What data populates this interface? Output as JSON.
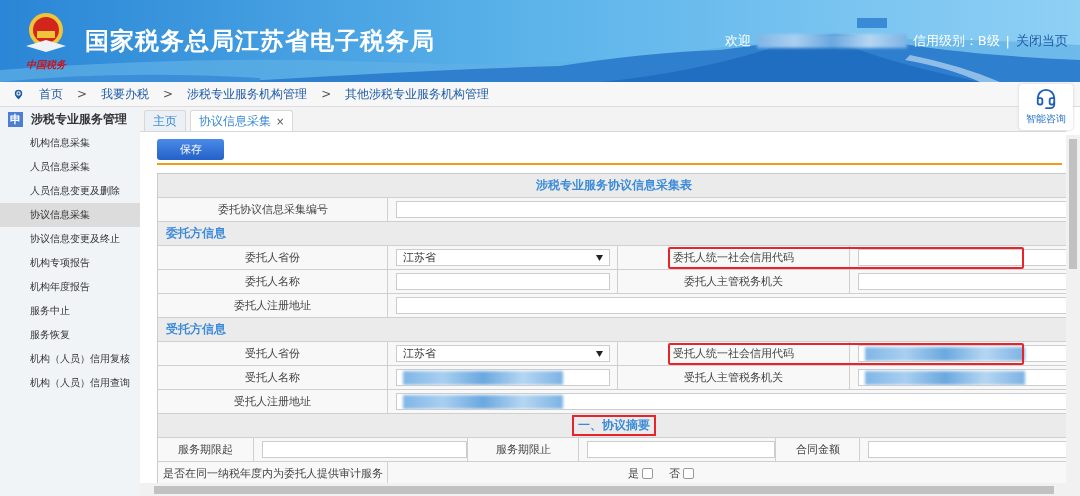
{
  "header": {
    "logo_caption": "中国税务",
    "title": "国家税务总局江苏省电子税务局",
    "welcome": "欢迎",
    "name_redacted": true,
    "credit": "信用级别：B级",
    "separator": "|",
    "close": "关闭当页"
  },
  "breadcrumb": {
    "separator": ">",
    "items": [
      "首页",
      "我要办税",
      "涉税专业服务机构管理",
      "其他涉税专业服务机构管理"
    ]
  },
  "assistant": {
    "label": "智能咨询"
  },
  "sidebar": {
    "badge": "申",
    "heading": "涉税专业服务管理",
    "items": [
      {
        "label": "机构信息采集",
        "selected": false
      },
      {
        "label": "人员信息采集",
        "selected": false
      },
      {
        "label": "人员信息变更及删除",
        "selected": false
      },
      {
        "label": "协议信息采集",
        "selected": true
      },
      {
        "label": "协议信息变更及终止",
        "selected": false
      },
      {
        "label": "机构专项报告",
        "selected": false
      },
      {
        "label": "机构年度报告",
        "selected": false
      },
      {
        "label": "服务中止",
        "selected": false
      },
      {
        "label": "服务恢复",
        "selected": false
      },
      {
        "label": "机构（人员）信用复核",
        "selected": false
      },
      {
        "label": "机构（人员）信用查询",
        "selected": false
      }
    ]
  },
  "tabs": [
    {
      "label": "主页",
      "selected": false
    },
    {
      "label": "协议信息采集",
      "selected": true,
      "close": "×"
    }
  ],
  "save_button": "保存",
  "form": {
    "title": "涉税专业服务协议信息采集表",
    "number_label": "委托协议信息采集编号",
    "sections": [
      {
        "heading": "委托方信息",
        "rows": [
          {
            "kind": "pair",
            "left": {
              "label": "委托人省份",
              "kind": "select",
              "value": "江苏省",
              "redacted": false
            },
            "right": {
              "label": "委托人统一社会信用代码",
              "highlighted": true,
              "redacted": false
            }
          },
          {
            "kind": "pair",
            "left": {
              "label": "委托人名称",
              "kind": "input",
              "redacted": false
            },
            "right": {
              "label": "委托人主管税务机关",
              "highlighted": false,
              "redacted": false
            }
          },
          {
            "kind": "wide",
            "label": "委托人注册地址",
            "redacted": false
          }
        ]
      },
      {
        "heading": "受托方信息",
        "rows": [
          {
            "kind": "pair",
            "left": {
              "label": "受托人省份",
              "kind": "select",
              "value": "江苏省",
              "redacted": false
            },
            "right": {
              "label": "受托人统一社会信用代码",
              "highlighted": true,
              "redacted": true
            }
          },
          {
            "kind": "pair",
            "left": {
              "label": "受托人名称",
              "kind": "input",
              "redacted": true
            },
            "right": {
              "label": "受托人主管税务机关",
              "highlighted": false,
              "redacted": true
            }
          },
          {
            "kind": "wide",
            "label": "受托人注册地址",
            "redacted": true
          }
        ]
      }
    ],
    "summary": {
      "heading": "一、协议摘要",
      "highlighted": true,
      "fields": [
        {
          "label": "服务期限起"
        },
        {
          "label": "服务期限止"
        },
        {
          "label": "合同金额"
        }
      ],
      "question": {
        "label": "是否在同一纳税年度内为委托人提供审计服务",
        "options": [
          {
            "label": "是",
            "checked": false
          },
          {
            "label": "否",
            "checked": false
          }
        ]
      }
    }
  }
}
